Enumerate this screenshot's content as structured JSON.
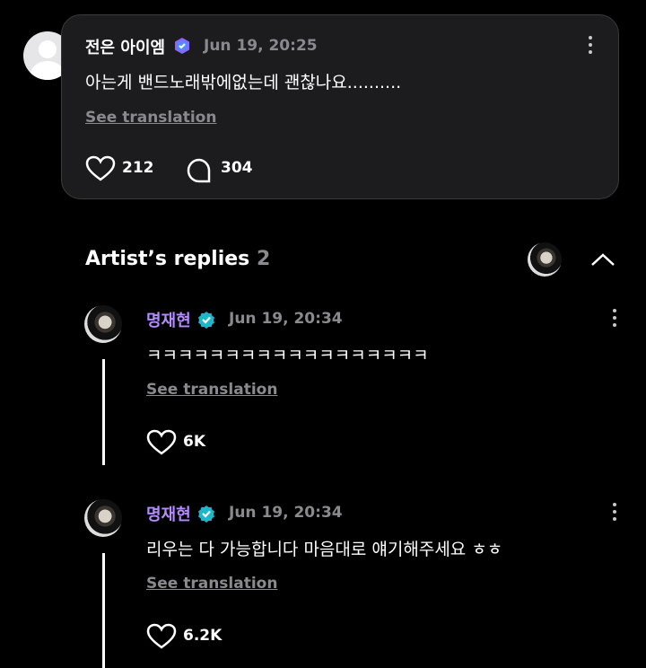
{
  "post": {
    "author": "전은 아이엠",
    "time": "Jun 19, 20:25",
    "text": "아는게 밴드노래밖에없는데 괜찮나요..........",
    "see_translation": "See translation",
    "likes": "212",
    "comments": "304"
  },
  "replies_header": {
    "title": "Artist’s replies",
    "count": "2"
  },
  "replies": [
    {
      "author": "명재현",
      "time": "Jun 19, 20:34",
      "text": "ㅋㅋㅋㅋㅋㅋㅋㅋㅋㅋㅋㅋㅋㅋㅋㅋㅋㅋ",
      "see_translation": "See translation",
      "likes": "6K"
    },
    {
      "author": "명재현",
      "time": "Jun 19, 20:34",
      "text": "리우는 다 가능합니다 마음대로 얘기해주세요 ㅎㅎ",
      "see_translation": "See translation",
      "likes": "6.2K"
    }
  ],
  "colors": {
    "background": "#000000",
    "card": "#1c1c1f",
    "artist_name": "#b58bff",
    "verified_badge": "#1db7c9",
    "muted": "#8a8a8e"
  }
}
